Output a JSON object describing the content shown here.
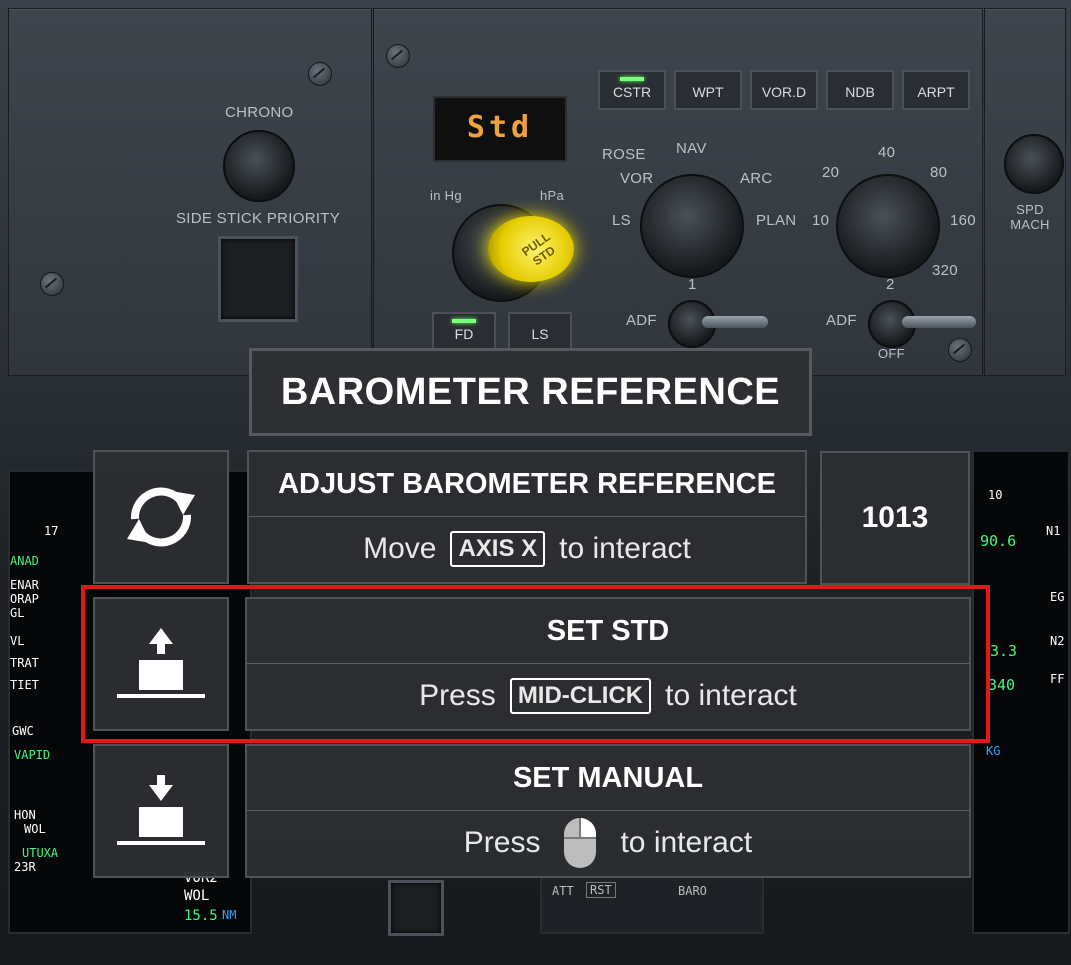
{
  "cockpit": {
    "chrono_label": "CHRONO",
    "side_stick_label": "SIDE STICK PRIORITY",
    "baro_display": "Std",
    "baro_unit_left": "in Hg",
    "baro_unit_right": "hPa",
    "pull_std_label": "PULL STD",
    "keys": [
      "CSTR",
      "WPT",
      "VOR.D",
      "NDB",
      "ARPT"
    ],
    "fd_label": "FD",
    "ls_key_label": "LS",
    "mode_labels": [
      "ROSE",
      "NAV",
      "VOR",
      "ARC",
      "LS",
      "PLAN"
    ],
    "range_labels": [
      "20",
      "40",
      "80",
      "10",
      "160",
      "320"
    ],
    "adf1_labels": [
      "1",
      "ADF"
    ],
    "adf2_labels": [
      "2",
      "ADF",
      "OFF"
    ],
    "spd_mach_label": "SPD MACH",
    "att_label": "ATT",
    "rst_label": "RST",
    "baro_lbl": "BARO",
    "nd_left": [
      "17",
      "ANAD",
      "ENAR",
      "ORAP",
      "GL",
      "VL",
      "TRAT",
      "TIET",
      "GWC",
      "VAPID",
      "HON",
      "WOL",
      "UTUXA",
      "23R"
    ],
    "nd_bottom": [
      "VOR2",
      "WOL",
      "15.5",
      "NM"
    ],
    "ecam_right": [
      "10",
      "90.6",
      "N1",
      "EG",
      "N2",
      "FF",
      "KG",
      "3.3",
      "340"
    ]
  },
  "tooltip": {
    "title": "BAROMETER REFERENCE",
    "value": "1013",
    "rows": [
      {
        "title": "ADJUST BAROMETER REFERENCE",
        "prefix": "Move",
        "chip": "AXIS X",
        "suffix": "to interact",
        "icon": "rotate-arrows-icon"
      },
      {
        "title": "SET STD",
        "prefix": "Press",
        "chip": "MID-CLICK",
        "suffix": "to interact",
        "icon": "pull-up-icon",
        "highlighted": true
      },
      {
        "title": "SET MANUAL",
        "prefix": "Press",
        "chip": "",
        "suffix": "to interact",
        "icon": "push-down-icon",
        "input_icon": "mouse-icon"
      }
    ]
  },
  "colors": {
    "highlight": "#e01a1a",
    "lcd": "#f0a23a",
    "led": "#7cff7a",
    "knob_glow": "#f5e000"
  }
}
